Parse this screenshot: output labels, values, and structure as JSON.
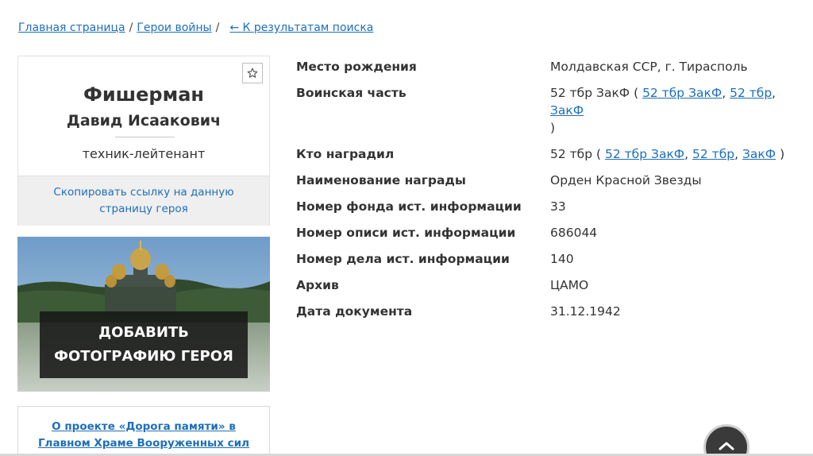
{
  "breadcrumb": {
    "home": "Главная страница",
    "sep1": "/",
    "section": "Герои войны",
    "sep2": "/",
    "back": "← К результатам поиска"
  },
  "hero": {
    "surname": "Фишерман",
    "name": "Давид Исаакович",
    "rank": "техник-лейтенант",
    "copy_link": "Скопировать ссылку на данную страницу героя",
    "star_icon": "star-outline-icon"
  },
  "photo": {
    "add_label": "ДОБАВИТЬ ФОТОГРАФИЮ ГЕРОЯ"
  },
  "about": {
    "text": "О проекте «Дорога памяти» в Главном Храме Вооруженных сил России"
  },
  "info": {
    "birthplace_label": "Место рождения",
    "birthplace": "Молдавская ССР, г. Тирасполь",
    "unit_label": "Воинская часть",
    "unit_prefix": "52 тбр ЗакФ (",
    "unit_links": [
      "52 тбр ЗакФ",
      "52 тбр",
      "ЗакФ"
    ],
    "unit_suffix": ")",
    "awarded_by_label": "Кто наградил",
    "awarded_by_prefix": "52 тбр (",
    "awarded_by_links": [
      "52 тбр ЗакФ",
      "52 тбр",
      "ЗакФ"
    ],
    "awarded_by_suffix": ")",
    "award_label": "Наименование награды",
    "award": "Орден Красной Звезды",
    "fond_label": "Номер фонда ист. информации",
    "fond": "33",
    "opis_label": "Номер описи ист. информации",
    "opis": "686044",
    "delo_label": "Номер дела ист. информации",
    "delo": "140",
    "archive_label": "Архив",
    "archive": "ЦАМО",
    "date_label": "Дата документа",
    "date": "31.12.1942",
    "comma": ","
  },
  "scroll_top_icon": "chevron-up-icon",
  "colors": {
    "link": "#1e6fb8",
    "text": "#333333",
    "overlay": "#181818"
  }
}
